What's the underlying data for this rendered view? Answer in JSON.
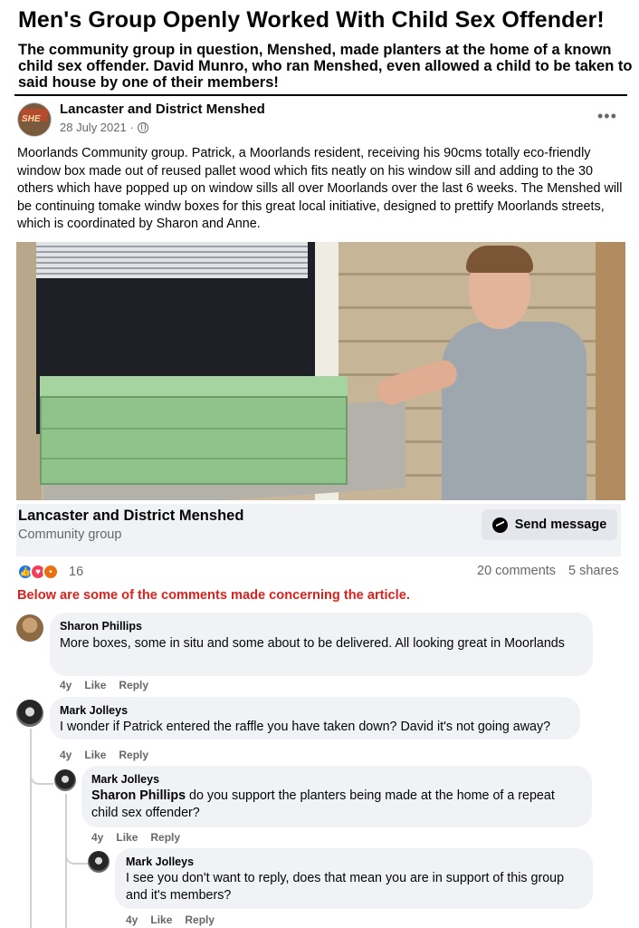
{
  "headline": "Men's Group Openly Worked With Child Sex Offender!",
  "subheadline": "The community group in question, Menshed, made planters at the home of a known child sex offender.  David Munro, who ran Menshed, even allowed a child to be taken to said house by one of their members!",
  "post": {
    "author": "Lancaster and District Menshed",
    "avatar_text": "SHE",
    "date": "28 July 2021 ·",
    "more": "•••",
    "text": "Moorlands Community group. Patrick, a Moorlands resident, receiving his 90cms totally eco-friendly window box made out of reused pallet wood which fits neatly on his window sill and adding to the 30 others which have popped up on window sills all over Moorlands over the last 6 weeks. The Menshed will be continuing  tomake windw boxes for this great local initiative, designed to prettify Moorlands streets, which is coordinated by Sharon and Anne.",
    "icons": [
      "globe-icon",
      "more-options-icon"
    ]
  },
  "page_card": {
    "name": "Lancaster and District Menshed",
    "type": "Community group",
    "button_label": "Send message",
    "button_icon": "messenger-icon"
  },
  "engagement": {
    "reaction_icons": [
      "like-icon",
      "love-icon",
      "angry-icon"
    ],
    "reaction_count": "16",
    "comments": "20 comments",
    "shares": "5 shares"
  },
  "note": "Below are some of the comments made concerning the article.",
  "comments": [
    {
      "author": "Sharon Phillips",
      "text": "More boxes, some in situ and some about to be delivered. All looking great in Moorlands",
      "time": "4y",
      "like": "Like",
      "reply": "Reply"
    },
    {
      "author": "Mark Jolleys",
      "text": "I wonder if Patrick entered the raffle you have taken down? David it's not going away?",
      "time": "4y",
      "like": "Like",
      "reply": "Reply"
    },
    {
      "author": "Mark Jolleys",
      "mention": "Sharon Phillips",
      "text": " do you support the planters being made at the home of a repeat child sex offender?",
      "time": "4y",
      "like": "Like",
      "reply": "Reply"
    },
    {
      "author": "Mark Jolleys",
      "text": "I see you don't want to reply, does that mean you are in support of this group and it's members?",
      "time": "4y",
      "like": "Like",
      "reply": "Reply"
    }
  ],
  "colors": {
    "note_red": "#e0201c",
    "bubble_bg": "#f0f2f5",
    "secondary_text": "#65676b",
    "like_blue": "#1877f2"
  }
}
